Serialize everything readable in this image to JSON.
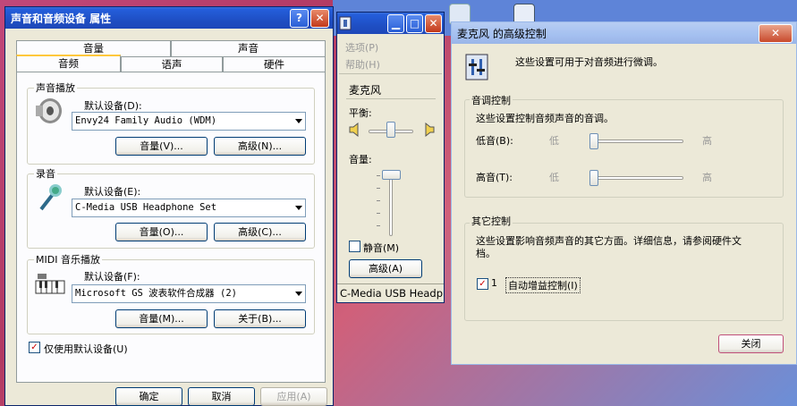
{
  "sound_props": {
    "title": "声音和音频设备 属性",
    "help_btn": "?",
    "close_btn": "✕",
    "tabs_back": [
      "音量",
      "声音"
    ],
    "tabs_front": [
      "音频",
      "语声",
      "硬件"
    ],
    "playback": {
      "group": "声音播放",
      "device_label": "默认设备(D):",
      "device_value": "Envy24 Family Audio (WDM)",
      "volume_btn": "音量(V)...",
      "advanced_btn": "高级(N)..."
    },
    "recording": {
      "group": "录音",
      "device_label": "默认设备(E):",
      "device_value": "C-Media USB Headphone Set",
      "volume_btn": "音量(O)...",
      "advanced_btn": "高级(C)..."
    },
    "midi": {
      "group": "MIDI 音乐播放",
      "device_label": "默认设备(F):",
      "device_value": "Microsoft GS 波表软件合成器 (2)",
      "volume_btn": "音量(M)...",
      "about_btn": "关于(B)..."
    },
    "only_default": "仅使用默认设备(U)",
    "ok": "确定",
    "cancel": "取消",
    "apply": "应用(A)"
  },
  "mixer": {
    "menu_options": "选项(P)",
    "menu_help": "帮助(H)",
    "channel": "麦克风",
    "balance": "平衡:",
    "volume": "音量:",
    "mute": "静音(M)",
    "advanced": "高级(A)",
    "status": "C-Media USB Headph",
    "min_btn": "▁",
    "max_btn": "□",
    "close_btn": "✕"
  },
  "advanced": {
    "title": "麦克风 的高级控制",
    "close_btn": "✕",
    "intro": "这些设置可用于对音频进行微调。",
    "tone_group": "音调控制",
    "tone_desc": "这些设置控制音频声音的音调。",
    "bass_label": "低音(B):",
    "treble_label": "高音(T):",
    "low": "低",
    "high": "高",
    "bass_level": 0,
    "treble_level": 0,
    "other_group": "其它控制",
    "other_desc": "这些设置影响音频声音的其它方面。详细信息，请参阅硬件文档。",
    "agc_prefix": "1",
    "agc_label": "自动增益控制(I)",
    "close_label": "关闭"
  }
}
